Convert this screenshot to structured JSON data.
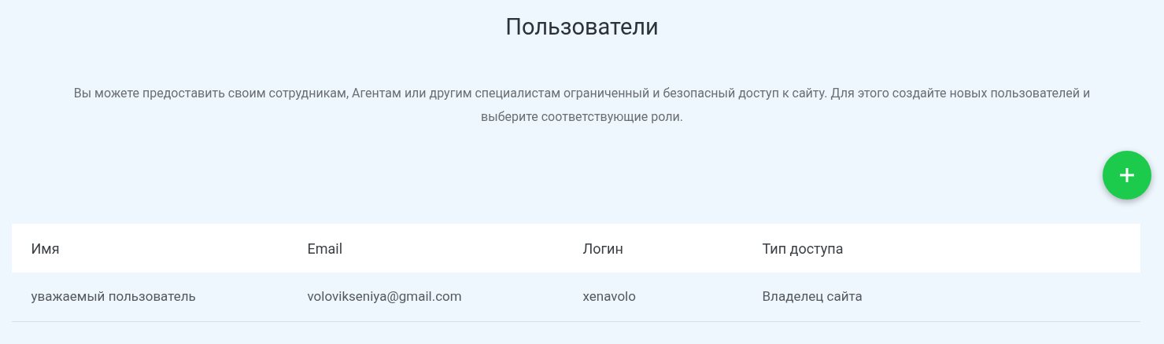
{
  "title": "Пользователи",
  "description": "Вы можете предоставить своим сотрудникам, Агентам или другим специалистам ограниченный и безопасный доступ к сайту. Для этого создайте новых пользователей и выберите соответствующие роли.",
  "table": {
    "columns": [
      "Имя",
      "Email",
      "Логин",
      "Тип доступа"
    ],
    "rows": [
      [
        "уважаемый пользователь",
        "volovikseniya@gmail.com",
        "xenavolo",
        "Владелец сайта"
      ]
    ]
  }
}
